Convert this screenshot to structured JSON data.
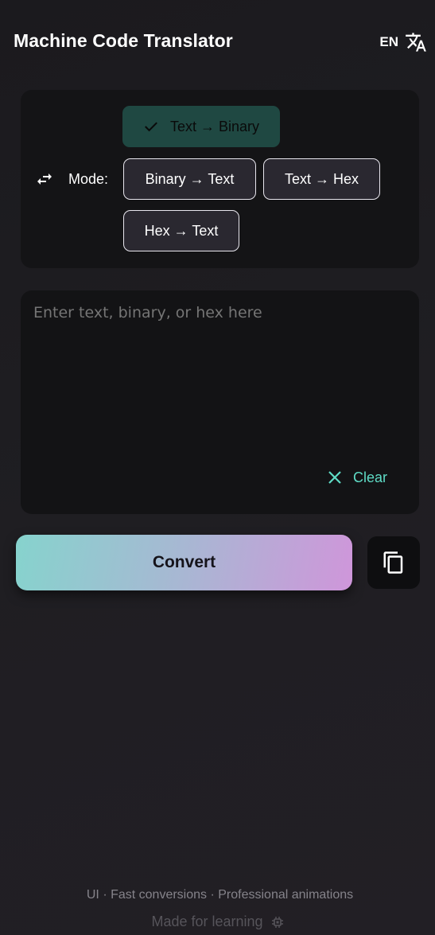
{
  "appbar": {
    "title": "Machine Code Translator",
    "language_code": "EN",
    "language_icon": "translate-icon"
  },
  "mode_card": {
    "label": "Mode:",
    "icon": "swap-horiz-icon",
    "options": [
      {
        "label": "Text → Binary",
        "selected": true
      },
      {
        "label": "Binary → Text",
        "selected": false
      },
      {
        "label": "Text → Hex",
        "selected": false
      },
      {
        "label": "Hex → Text",
        "selected": false
      }
    ]
  },
  "input": {
    "placeholder": "Enter text, binary, or hex here",
    "value": "",
    "clear_label": "Clear"
  },
  "actions": {
    "convert_label": "Convert",
    "copy_icon": "copy-icon"
  },
  "footer": {
    "tagline": "UI · Fast conversions · Professional animations",
    "made_for": "Made for learning",
    "made_icon": "chip-icon"
  },
  "colors": {
    "background": "#1e1d21",
    "card": "#141416",
    "selected_chip": "#1f4842",
    "accent": "#5fdcc6",
    "gradient_start": "#86d3cd",
    "gradient_end": "#cf96da"
  }
}
